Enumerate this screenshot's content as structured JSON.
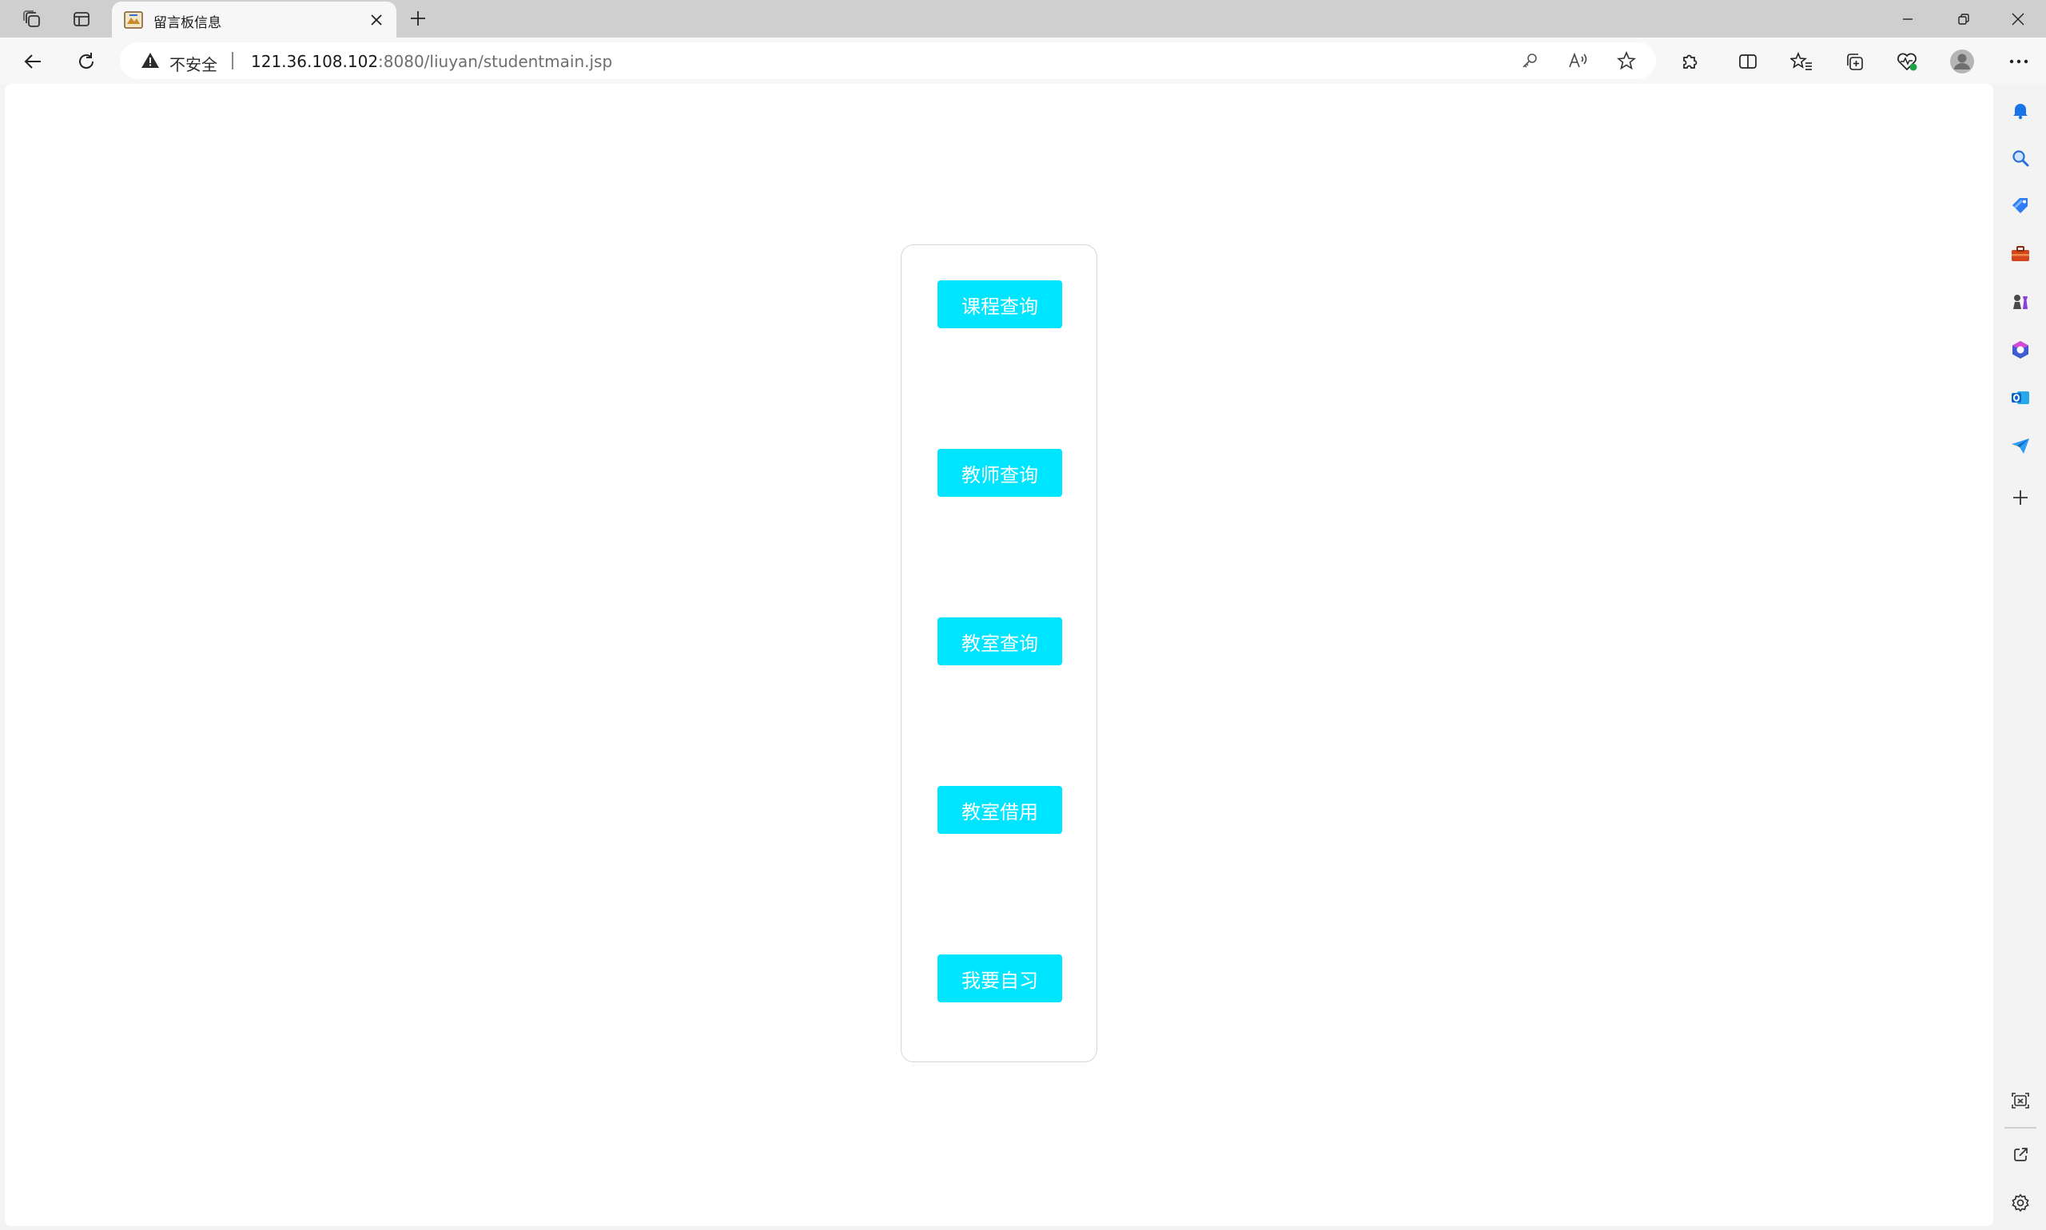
{
  "browser": {
    "tab": {
      "title": "留言板信息",
      "close_icon": "close-icon"
    },
    "new_tab_icon": "plus-icon",
    "address": {
      "security_label": "不安全",
      "url_host": "121.36.108.102",
      "url_rest": ":8080/liuyan/studentmain.jsp"
    }
  },
  "page": {
    "menu_buttons": [
      {
        "label": "课程查询"
      },
      {
        "label": "教师查询"
      },
      {
        "label": "教室查询"
      },
      {
        "label": "教室借用"
      },
      {
        "label": "我要自习"
      }
    ],
    "button_color": "#00e5ff",
    "button_text_color": "#ffffff"
  },
  "sidebar": {
    "items": [
      "bell-icon",
      "search-icon",
      "tag-icon",
      "briefcase-icon",
      "chess-icon",
      "office-icon",
      "outlook-icon",
      "send-icon",
      "plus-icon"
    ],
    "bottom_items": [
      "screenshot-icon",
      "open-external-icon",
      "settings-icon"
    ]
  }
}
